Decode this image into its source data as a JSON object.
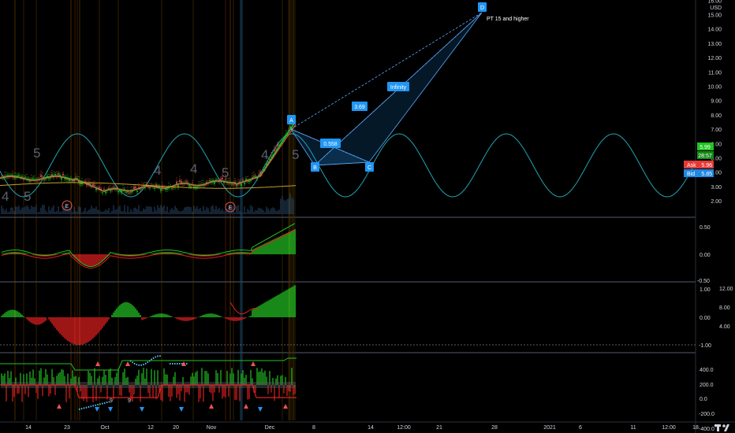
{
  "price_axis": {
    "currency": "USD",
    "ticks": [
      "16.00",
      "15.00",
      "14.00",
      "13.00",
      "12.00",
      "11.00",
      "10.00",
      "9.00",
      "8.00",
      "7.00",
      "6.00",
      "5.00",
      "4.00",
      "3.00",
      "2.00"
    ],
    "ticks_values": [
      16,
      15,
      14,
      13,
      12,
      11,
      10,
      9,
      8,
      7,
      6,
      5,
      4,
      3,
      2
    ]
  },
  "price_tags": {
    "last": "5.99",
    "countdown": "28:57",
    "ask_label": "Ask",
    "ask": "5.96",
    "bid_label": "Bid",
    "bid": "5.85"
  },
  "pattern": {
    "points": [
      "A",
      "B",
      "C",
      "D"
    ],
    "ratios": [
      "0.558",
      "3.69",
      "Infinity"
    ],
    "target_label": "PT 15 and higher"
  },
  "markers": {
    "earnings": [
      "E",
      "E"
    ],
    "counts": [
      "5",
      "4",
      "5",
      "4",
      "4",
      "5",
      "4",
      "5"
    ]
  },
  "date_axis": [
    "14",
    "23",
    "Oct",
    "12",
    "20",
    "Nov",
    "Dec",
    "8",
    "14",
    "12:00",
    "21",
    "28",
    "2021",
    "6",
    "11",
    "12:00",
    "18"
  ],
  "pane2_axis": [
    "0.50",
    "0.00",
    "-0.50"
  ],
  "pane3_axis": [
    "12.00",
    "8.00",
    "1.00",
    "4.00",
    "0.00",
    "-1.00"
  ],
  "pane4_axis": [
    "400.0",
    "200.0",
    "0.0",
    "-200.0",
    "-400.0"
  ],
  "markers_small": [
    "9",
    "9"
  ],
  "colors": {
    "background": "#000000",
    "bull": "#26a69a",
    "green": "#22c322",
    "bear": "#ef5350",
    "red": "#e02020",
    "cycle": "#1fa5b5",
    "pattern": "#2196f3",
    "axis_text": "#d1d4dc",
    "ask_bg": "#e53935",
    "bid_bg": "#1e88e5",
    "last_bg": "#20c020"
  }
}
